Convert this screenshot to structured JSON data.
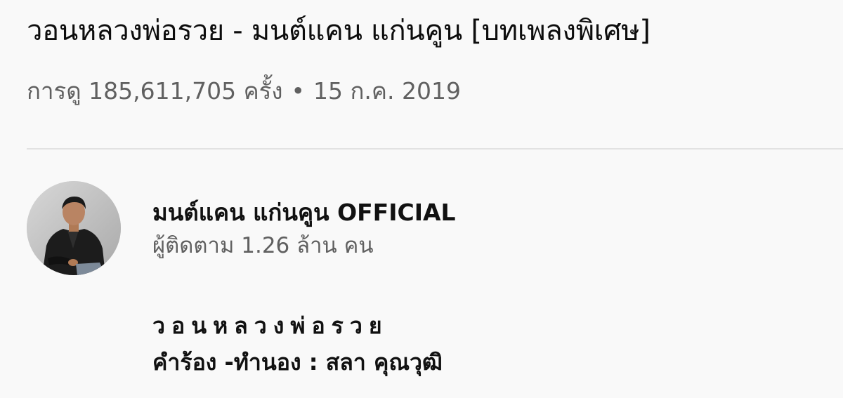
{
  "video": {
    "title": "วอนหลวงพ่อรวย - มนต์แคน แก่นคูน [บทเพลงพิเศษ]",
    "views": "การดู 185,611,705 ครั้ง",
    "separator": "•",
    "date": "15 ก.ค. 2019"
  },
  "channel": {
    "name": "มนต์แคน แก่นคูน OFFICIAL",
    "subscribers": "ผู้ติดตาม 1.26 ล้าน คน",
    "avatar_icon": "channel-avatar-photo"
  },
  "description": {
    "song_title": "วอนหลวงพ่อรวย",
    "credit": "คำร้อง -ทำนอง : สลา คุณวุฒิ"
  },
  "colors": {
    "background": "#f9f9f9",
    "text_primary": "#0f0f0f",
    "text_secondary": "#606060",
    "divider": "#e2e2e2"
  }
}
